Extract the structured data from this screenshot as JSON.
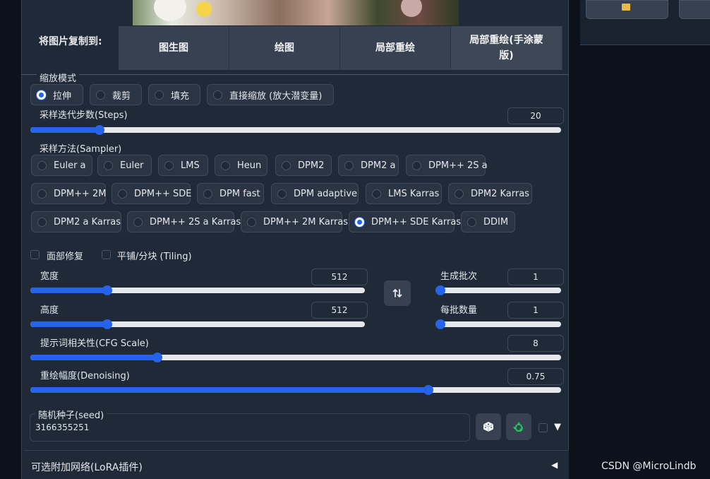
{
  "copy_to": {
    "label": "将图片复制到:",
    "buttons": [
      "图生图",
      "绘图",
      "局部重绘",
      "局部重绘(手涂蒙",
      "版)"
    ]
  },
  "resize_mode": {
    "label": "缩放模式",
    "options": [
      "拉伸",
      "裁剪",
      "填充",
      "直接缩放 (放大潜变量)"
    ],
    "selected": "拉伸"
  },
  "steps": {
    "label": "采样迭代步数(Steps)",
    "value": "20",
    "fraction": 0.13
  },
  "sampler": {
    "label": "采样方法(Sampler)",
    "options": [
      "Euler a",
      "Euler",
      "LMS",
      "Heun",
      "DPM2",
      "DPM2 a",
      "DPM++ 2S a",
      "DPM++ 2M",
      "DPM++ SDE",
      "DPM fast",
      "DPM adaptive",
      "LMS Karras",
      "DPM2 Karras",
      "DPM2 a Karras",
      "DPM++ 2S a Karras",
      "DPM++ 2M Karras",
      "DPM++ SDE Karras",
      "DDIM"
    ],
    "selected": "DPM++ SDE Karras"
  },
  "checkboxes": {
    "face_restore": "面部修复",
    "tiling": "平铺/分块 (Tiling)"
  },
  "width": {
    "label": "宽度",
    "value": "512",
    "fraction": 0.23
  },
  "height": {
    "label": "高度",
    "value": "512",
    "fraction": 0.23
  },
  "batch_count": {
    "label": "生成批次",
    "value": "1",
    "fraction": 0.0
  },
  "batch_size": {
    "label": "每批数量",
    "value": "1",
    "fraction": 0.0
  },
  "cfg": {
    "label": "提示词相关性(CFG Scale)",
    "value": "8",
    "fraction": 0.24
  },
  "denoising": {
    "label": "重绘幅度(Denoising)",
    "value": "0.75",
    "fraction": 0.75
  },
  "seed": {
    "label": "随机种子(seed)",
    "value": "3166355251"
  },
  "lora": {
    "label": "可选附加网络(LoRA插件)"
  },
  "watermark": "CSDN @MicroLindb",
  "icons": {
    "swap": "swap-icon",
    "dice": "dice-icon",
    "recycle": "recycle-icon",
    "collapse": "triangle-left-icon",
    "dropdown": "triangle-down-icon",
    "folder": "folder-icon"
  },
  "colors": {
    "accent": "#2563eb",
    "panel": "#1f2937",
    "recycle": "#22c55e"
  }
}
